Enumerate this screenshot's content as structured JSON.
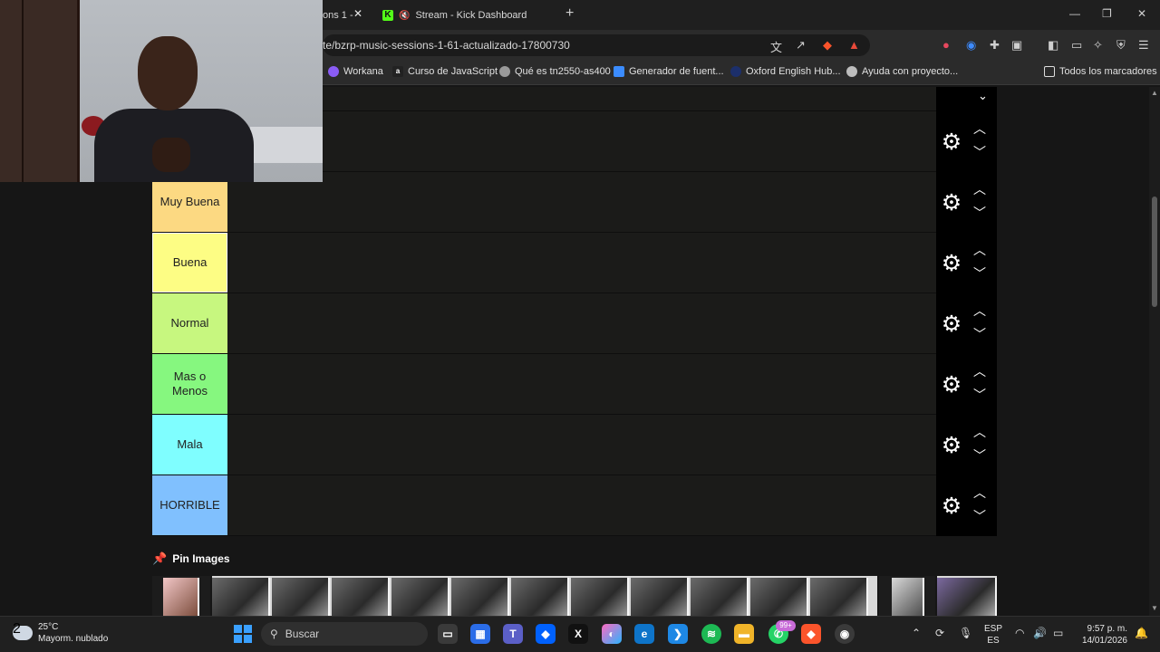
{
  "browser": {
    "tab1_label": "ons 1 -",
    "tab1_close": "✕",
    "tab2_label": "Stream - Kick Dashboard",
    "tab2_favicon": "K",
    "tab2_mute": "🔇",
    "new_tab": "+",
    "minimize": "—",
    "maximize": "❐",
    "close": "✕",
    "url": "te/bzrp-music-sessions-1-61-actualizado-17800730",
    "bookmarks": [
      {
        "label": "Workana",
        "icon": "workana-icon"
      },
      {
        "label": "Curso de JavaScript",
        "icon": "a"
      },
      {
        "label": "Qué es tn2550-as400",
        "icon": "globe-icon"
      },
      {
        "label": "Generador de fuent...",
        "icon": "text-generator-icon"
      },
      {
        "label": "Oxford English Hub...",
        "icon": "oxford-icon"
      },
      {
        "label": "Ayuda con proyecto...",
        "icon": "chatgpt-icon"
      },
      {
        "label": "Todos los marcadores",
        "icon": "folder-icon"
      }
    ]
  },
  "tiers": [
    {
      "label": "Muy Buena",
      "color": "#fcd982"
    },
    {
      "label": "Buena",
      "color": "#fdfd84",
      "selected": true
    },
    {
      "label": "Normal",
      "color": "#c7f77f"
    },
    {
      "label": "Mas o Menos",
      "color": "#86f77f"
    },
    {
      "label": "Mala",
      "color": "#7ffeff"
    },
    {
      "label": "HORRIBLE",
      "color": "#80c0fe"
    }
  ],
  "pin_images_label": "Pin Images",
  "taskbar": {
    "weather_temp": "25°C",
    "weather_desc": "Mayorm. nublado",
    "weather_badge": "2",
    "search_placeholder": "Buscar",
    "notif_badge": "99+",
    "lang_line1": "ESP",
    "lang_line2": "ES",
    "time": "9:57 p. m.",
    "date": "14/01/2026"
  }
}
